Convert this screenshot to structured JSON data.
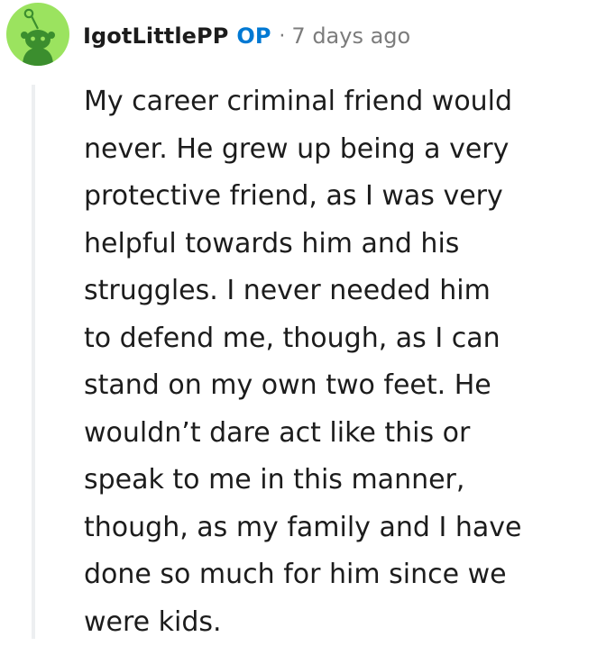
{
  "comment": {
    "author": "IgotLittlePP",
    "op_badge": "OP",
    "separator": "·",
    "timestamp": "7 days ago",
    "avatar_icon": "snoo-avatar-icon",
    "body_lines": [
      "My career criminal friend would",
      "never. He grew up being a very",
      "protective friend, as I was very",
      "helpful towards him and his",
      "struggles. I never needed him",
      "to defend me, though, as I can",
      "stand on my own two feet. He",
      "wouldn’t dare act like this or",
      "speak to me in this manner,",
      "though, as my family and I have",
      "done so much for him since we",
      "were kids."
    ]
  },
  "colors": {
    "avatar_background": "#9be35f",
    "op_badge": "#0079d3",
    "meta_text": "#7c7c7c",
    "body_text": "#1c1c1c",
    "thread_line": "#edeff1"
  }
}
